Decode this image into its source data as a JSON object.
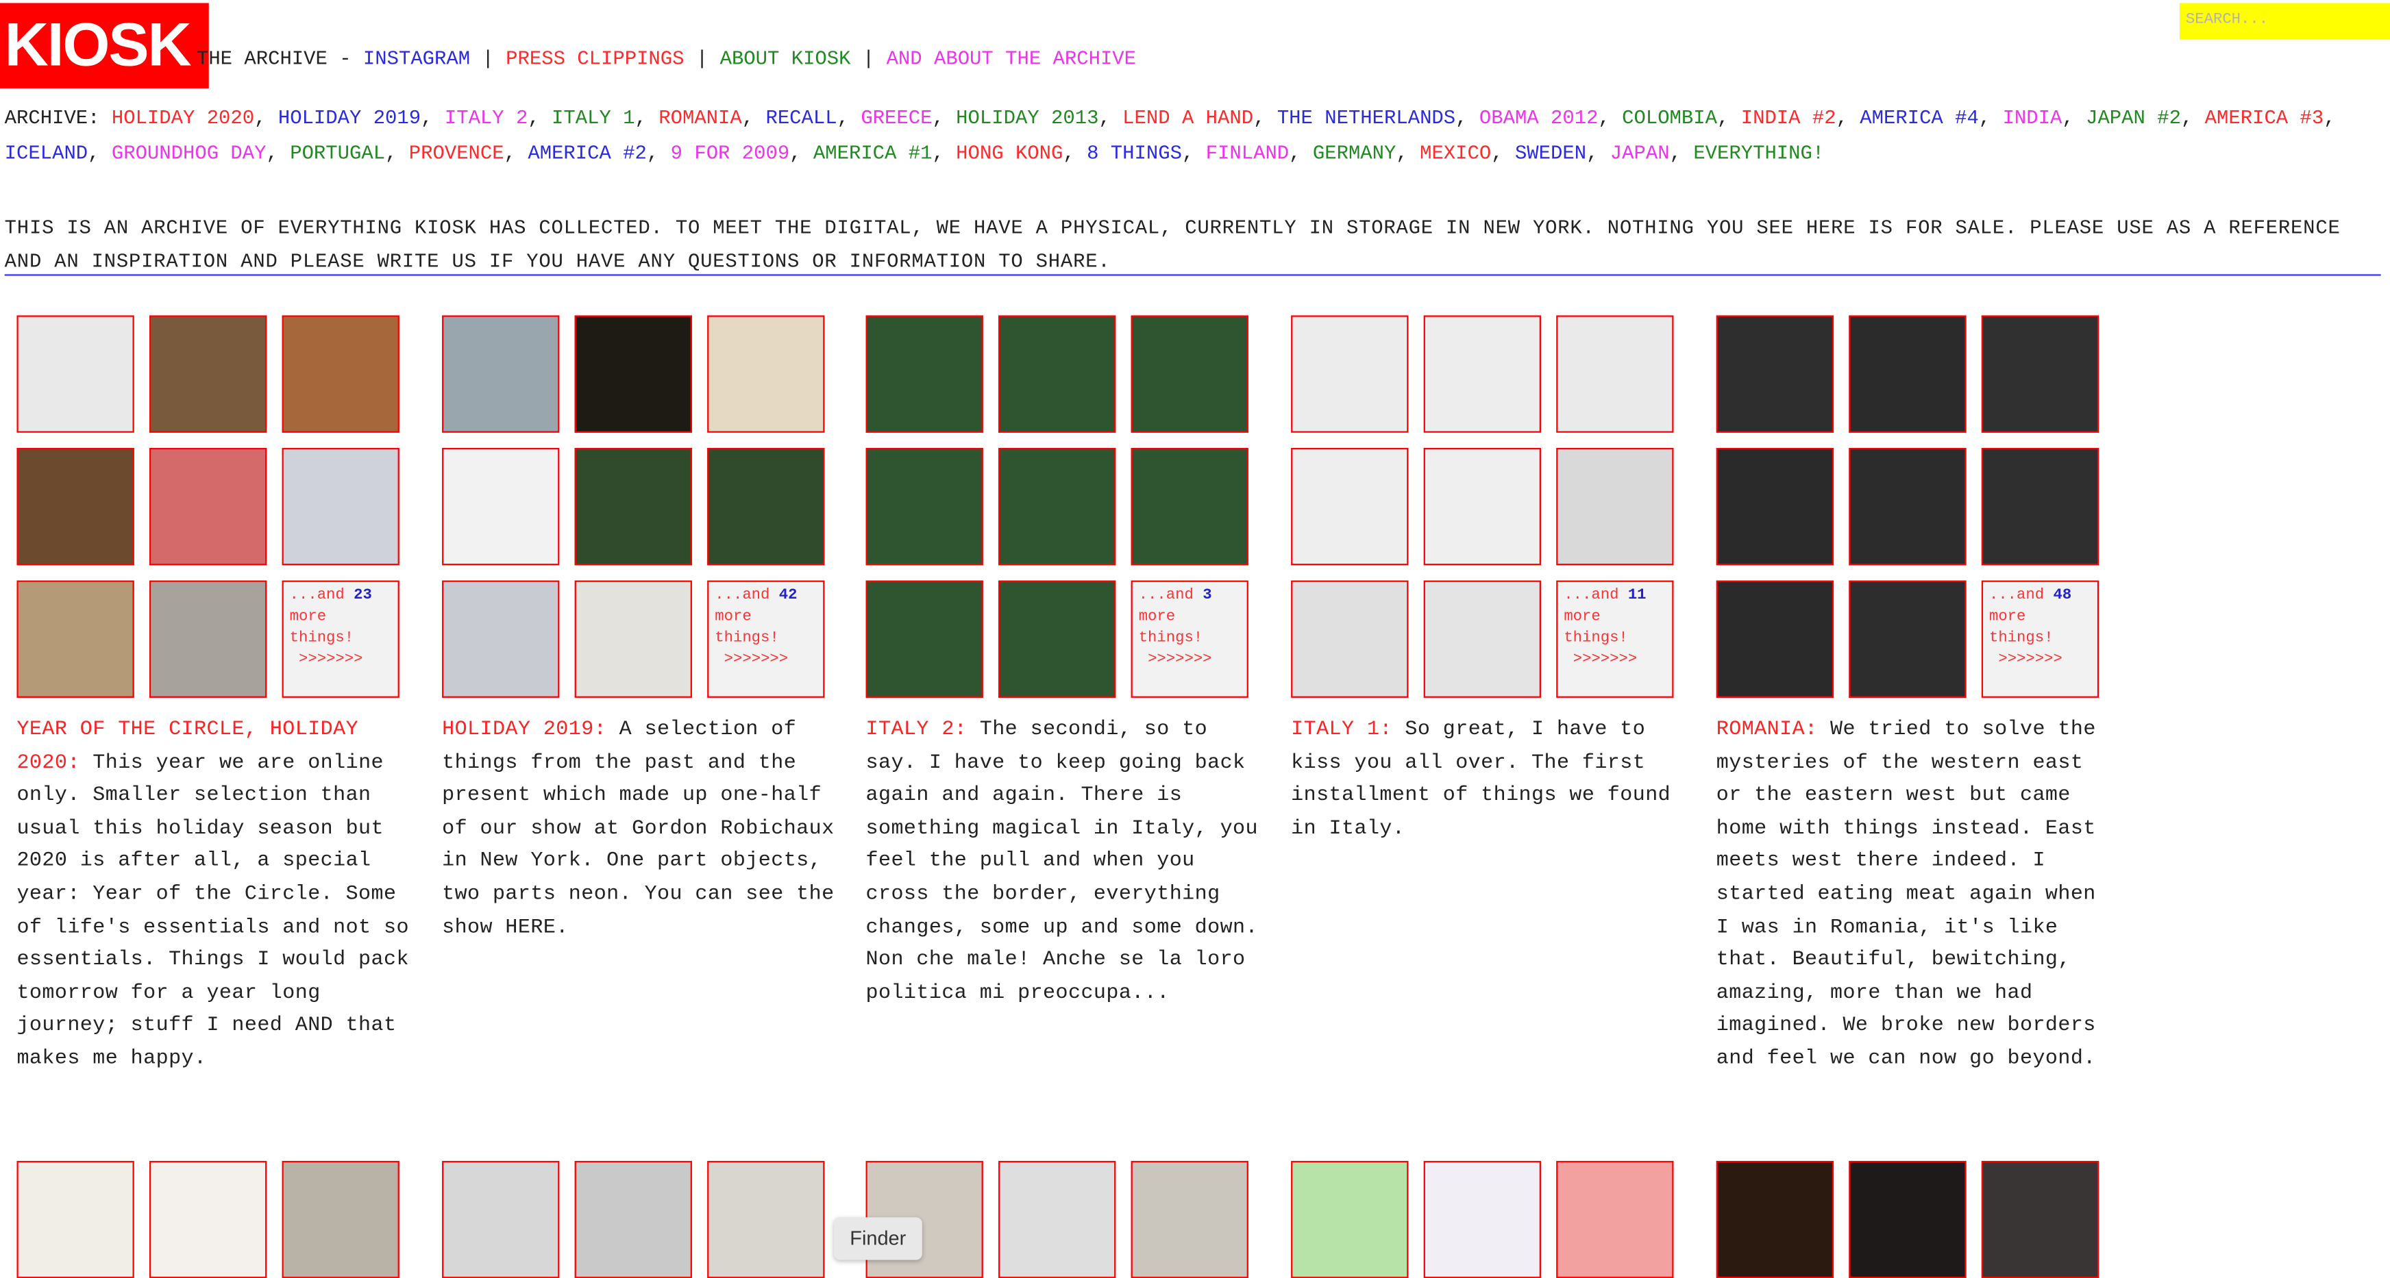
{
  "header": {
    "logo": "KIOSK",
    "nav": [
      {
        "label": "THE ARCHIVE - ",
        "color": "black"
      },
      {
        "label": "INSTAGRAM",
        "color": "blue"
      },
      {
        "label": " | ",
        "color": "black"
      },
      {
        "label": "PRESS CLIPPINGS",
        "color": "red"
      },
      {
        "label": " | ",
        "color": "black"
      },
      {
        "label": "ABOUT KIOSK",
        "color": "green"
      },
      {
        "label": " | ",
        "color": "black"
      },
      {
        "label": "AND ABOUT THE ARCHIVE",
        "color": "pink"
      }
    ],
    "search_placeholder": "SEARCH..."
  },
  "archive": {
    "prefix": "ARCHIVE: ",
    "links": [
      {
        "label": "HOLIDAY 2020",
        "color": "red"
      },
      {
        "label": "HOLIDAY 2019",
        "color": "blue"
      },
      {
        "label": "ITALY 2",
        "color": "pink"
      },
      {
        "label": "ITALY 1",
        "color": "green"
      },
      {
        "label": "ROMANIA",
        "color": "red"
      },
      {
        "label": "RECALL",
        "color": "blue"
      },
      {
        "label": "GREECE",
        "color": "pink"
      },
      {
        "label": "HOLIDAY 2013",
        "color": "green"
      },
      {
        "label": "LEND A HAND",
        "color": "red"
      },
      {
        "label": "THE NETHERLANDS",
        "color": "blue"
      },
      {
        "label": "OBAMA 2012",
        "color": "pink"
      },
      {
        "label": "COLOMBIA",
        "color": "green"
      },
      {
        "label": "INDIA #2",
        "color": "red"
      },
      {
        "label": "AMERICA #4",
        "color": "blue"
      },
      {
        "label": "INDIA",
        "color": "pink"
      },
      {
        "label": "JAPAN #2",
        "color": "green"
      },
      {
        "label": "AMERICA #3",
        "color": "red"
      },
      {
        "label": "ICELAND",
        "color": "blue"
      },
      {
        "label": "GROUNDHOG DAY",
        "color": "pink"
      },
      {
        "label": "PORTUGAL",
        "color": "green"
      },
      {
        "label": "PROVENCE",
        "color": "red"
      },
      {
        "label": "AMERICA #2",
        "color": "blue"
      },
      {
        "label": "9 FOR 2009",
        "color": "pink"
      },
      {
        "label": "AMERICA #1",
        "color": "green"
      },
      {
        "label": "HONG KONG",
        "color": "red"
      },
      {
        "label": "8 THINGS",
        "color": "blue"
      },
      {
        "label": "FINLAND",
        "color": "pink"
      },
      {
        "label": "GERMANY",
        "color": "green"
      },
      {
        "label": "MEXICO",
        "color": "red"
      },
      {
        "label": "SWEDEN",
        "color": "blue"
      },
      {
        "label": "JAPAN",
        "color": "pink"
      },
      {
        "label": "EVERYTHING!",
        "color": "green"
      }
    ]
  },
  "intro": "THIS IS AN ARCHIVE OF EVERYTHING KIOSK HAS COLLECTED. TO MEET THE DIGITAL, WE HAVE A PHYSICAL, CURRENTLY IN STORAGE IN NEW YORK. NOTHING YOU SEE HERE IS FOR SALE. PLEASE USE AS A REFERENCE AND AN INSPIRATION AND PLEASE WRITE US IF YOU HAVE ANY QUESTIONS OR INFORMATION TO SHARE.",
  "more_text": {
    "prefix": "...and",
    "suffix1": "more",
    "suffix2": "things!",
    "arrows": ">>>>>>>"
  },
  "collections": [
    {
      "title": "YEAR OF THE CIRCLE, HOLIDAY 2020:",
      "body": " This year we are online only. Smaller selection than usual this holiday season but 2020 is after all, a special year: Year of the Circle. Some of life's essentials and not so essentials. Things I would pack tomorrow for a year long journey; stuff I need AND that makes me happy.",
      "more_count": "23",
      "tiles": [
        "#e9e9e9",
        "#7a5a3c",
        "#a6683a",
        "#6b4a2e",
        "#d46a6a",
        "#cfd2da",
        "#b59a78",
        "#a7a39c"
      ]
    },
    {
      "title": "HOLIDAY 2019:",
      "body": " A selection of things from the past and the present which made up one-half of our show at Gordon Robichaux in New York. One part objects, two parts neon. You can see the show HERE.",
      "more_count": "42",
      "tiles": [
        "#9aa6ae",
        "#1e1a14",
        "#e6d9c4",
        "#f2f2f2",
        "#2f4b2c",
        "#2f4b2c",
        "#c8ccd2",
        "#e4e2dc"
      ]
    },
    {
      "title": "ITALY 2:",
      "body": " The secondi, so to say. I have to keep going back again and again. There is something magical in Italy, you feel the pull and when you cross the border, everything changes, some up and some down. Non che male! Anche se la loro politica mi preoccupa...",
      "more_count": "3",
      "tiles": [
        "#2f5530",
        "#2f5530",
        "#2f5530",
        "#2f5530",
        "#2f5530",
        "#2f5530",
        "#2f5530",
        "#2f5530"
      ]
    },
    {
      "title": "ITALY 1:",
      "body": " So great, I have to kiss you all over. The first installment of things we found in Italy.",
      "more_count": "11",
      "tiles": [
        "#ececec",
        "#ededed",
        "#eaeaea",
        "#eeeeee",
        "#efefef",
        "#d9d9d9",
        "#e0e0e0",
        "#e4e4e4"
      ]
    },
    {
      "title": "ROMANIA:",
      "body": " We tried to solve the mysteries of the western east or the eastern west but came home with things instead. East meets west there indeed. I started eating meat again when I was in Romania, it's like that. Beautiful, bewitching, amazing, more than we had imagined. We broke new borders and feel we can now go beyond.",
      "more_count": "48",
      "tiles": [
        "#2e2e2e",
        "#2b2b2b",
        "#303030",
        "#2a2a2a",
        "#2c2c2c",
        "#2f2f2f",
        "#2a2a2a",
        "#2d2d2d"
      ]
    }
  ],
  "row2_tiles": [
    "#f1eee8",
    "#f4f1ec",
    "#b9b2a7",
    "#d7d7d7",
    "#c9c9c9",
    "#d9d5cf",
    "#cfc9c0",
    "#dedede",
    "#cbc6bd",
    "#b7e3a9",
    "#f2eef5",
    "#f2a0a0",
    "#2a1a10",
    "#1e1a1a",
    "#3a3535"
  ],
  "finder_label": "Finder",
  "colors": {
    "red": "#ff2a2a",
    "blue": "#2a2ae0",
    "green": "#1f8a1f",
    "pink": "#ee33ee",
    "black": "#222222",
    "search_bg": "#ffff00",
    "tile_border": "#ff0000"
  }
}
